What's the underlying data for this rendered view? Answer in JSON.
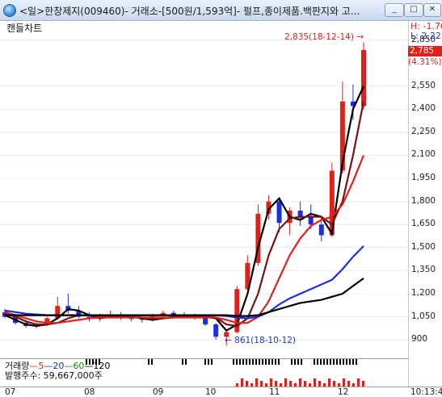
{
  "window": {
    "title": "<일>한창제지(009460)- 거래소-[500원/1,593억]- 펄프,종이제품.백판지와 고...",
    "minimize_label": "_",
    "restore_label": "□",
    "close_label": "✕"
  },
  "chart_label": "캔들차트",
  "price_panel": {
    "high_label": "H: -1.76",
    "current_price": "2,785",
    "change_pct": "(4.31%)",
    "low_label": "L: 2,223"
  },
  "annotations": {
    "high": "2,835(18-12-14) →",
    "low": "← 861(18-10-12)"
  },
  "volume_legend": {
    "title": "거래량",
    "ma5": "—5",
    "ma20": "—20",
    "ma60": "—60",
    "ma120": "—120"
  },
  "shares_outstanding": "발행주수: 59,667,000주",
  "clock": "10:13:4",
  "colors": {
    "up": "#e0201a",
    "down": "#1c2fe0",
    "ma5": "#000000",
    "ma20": "#7a1010",
    "ma60": "#e0201a",
    "ma120": "#1c2fe0",
    "ma240": "#000000"
  },
  "chart_data": {
    "type": "candlestick",
    "title": "캔들차트",
    "ylim": [
      780,
      2900
    ],
    "yticks": [
      900,
      1050,
      1200,
      1350,
      1500,
      1650,
      1800,
      1950,
      2100,
      2250,
      2400,
      2550,
      2850
    ],
    "ytick_labels": [
      "900",
      "1,050",
      "1,200",
      "1,350",
      "1,500",
      "1,650",
      "1,800",
      "1,950",
      "2,100",
      "2,250",
      "2,400",
      "2,550",
      "2,850"
    ],
    "x_labels": [
      "07",
      "08",
      "09",
      "10",
      "11",
      "12"
    ],
    "high_point": {
      "value": 2835,
      "date": "18-12-14"
    },
    "low_point": {
      "value": 861,
      "date": "18-10-12"
    },
    "last_close": 2785,
    "series": [
      {
        "name": "5",
        "color": "#000000",
        "values": [
          1060,
          1030,
          1000,
          990,
          1000,
          1040,
          1100,
          1090,
          1060,
          1040,
          1050,
          1060,
          1050,
          1040,
          1030,
          1040,
          1050,
          1060,
          1060,
          1050,
          1040,
          960,
          1000,
          1200,
          1500,
          1750,
          1820,
          1700,
          1680,
          1720,
          1700,
          1590,
          2050,
          2400,
          2550
        ]
      },
      {
        "name": "20",
        "color": "#7a1010",
        "values": [
          1070,
          1050,
          1020,
          1000,
          1000,
          1010,
          1040,
          1060,
          1060,
          1050,
          1050,
          1050,
          1050,
          1045,
          1040,
          1040,
          1045,
          1050,
          1055,
          1050,
          1045,
          1000,
          990,
          1040,
          1200,
          1450,
          1620,
          1690,
          1700,
          1700,
          1700,
          1650,
          1800,
          2100,
          2450
        ]
      },
      {
        "name": "60",
        "color": "#e0201a",
        "values": [
          1080,
          1060,
          1040,
          1020,
          1010,
          1010,
          1020,
          1030,
          1040,
          1045,
          1045,
          1045,
          1045,
          1045,
          1045,
          1045,
          1045,
          1045,
          1045,
          1045,
          1045,
          1030,
          1010,
          1010,
          1050,
          1150,
          1300,
          1450,
          1560,
          1640,
          1680,
          1700,
          1780,
          1930,
          2100
        ]
      },
      {
        "name": "120",
        "color": "#1c2fe0",
        "values": [
          1090,
          1080,
          1070,
          1065,
          1060,
          1060,
          1060,
          1060,
          1060,
          1060,
          1060,
          1060,
          1060,
          1060,
          1060,
          1060,
          1060,
          1060,
          1060,
          1060,
          1060,
          1055,
          1045,
          1040,
          1050,
          1080,
          1130,
          1170,
          1200,
          1230,
          1260,
          1290,
          1360,
          1440,
          1510
        ]
      },
      {
        "name": "240",
        "color": "#000000",
        "values": [
          1060,
          1060,
          1060,
          1060,
          1060,
          1060,
          1060,
          1060,
          1060,
          1060,
          1060,
          1060,
          1060,
          1060,
          1060,
          1060,
          1060,
          1060,
          1060,
          1060,
          1060,
          1060,
          1055,
          1055,
          1060,
          1080,
          1100,
          1120,
          1140,
          1150,
          1160,
          1180,
          1200,
          1250,
          1300
        ]
      }
    ],
    "candles": [
      {
        "o": 1080,
        "h": 1100,
        "l": 1040,
        "c": 1050
      },
      {
        "o": 1050,
        "h": 1070,
        "l": 1000,
        "c": 1010
      },
      {
        "o": 1010,
        "h": 1030,
        "l": 980,
        "c": 990
      },
      {
        "o": 990,
        "h": 1010,
        "l": 975,
        "c": 1000
      },
      {
        "o": 1000,
        "h": 1050,
        "l": 990,
        "c": 1040
      },
      {
        "o": 1040,
        "h": 1180,
        "l": 1030,
        "c": 1120
      },
      {
        "o": 1120,
        "h": 1200,
        "l": 1070,
        "c": 1090
      },
      {
        "o": 1090,
        "h": 1120,
        "l": 1040,
        "c": 1050
      },
      {
        "o": 1050,
        "h": 1080,
        "l": 1020,
        "c": 1040
      },
      {
        "o": 1040,
        "h": 1070,
        "l": 1020,
        "c": 1055
      },
      {
        "o": 1055,
        "h": 1090,
        "l": 1040,
        "c": 1060
      },
      {
        "o": 1060,
        "h": 1080,
        "l": 1030,
        "c": 1045
      },
      {
        "o": 1045,
        "h": 1060,
        "l": 1020,
        "c": 1035
      },
      {
        "o": 1035,
        "h": 1050,
        "l": 1010,
        "c": 1030
      },
      {
        "o": 1030,
        "h": 1070,
        "l": 1020,
        "c": 1060
      },
      {
        "o": 1060,
        "h": 1090,
        "l": 1040,
        "c": 1075
      },
      {
        "o": 1075,
        "h": 1090,
        "l": 1050,
        "c": 1060
      },
      {
        "o": 1060,
        "h": 1080,
        "l": 1040,
        "c": 1050
      },
      {
        "o": 1050,
        "h": 1070,
        "l": 1030,
        "c": 1040
      },
      {
        "o": 1040,
        "h": 1050,
        "l": 990,
        "c": 1000
      },
      {
        "o": 1000,
        "h": 1010,
        "l": 900,
        "c": 920
      },
      {
        "o": 920,
        "h": 960,
        "l": 861,
        "c": 950
      },
      {
        "o": 950,
        "h": 1250,
        "l": 940,
        "c": 1230
      },
      {
        "o": 1230,
        "h": 1450,
        "l": 1200,
        "c": 1400
      },
      {
        "o": 1400,
        "h": 1780,
        "l": 1380,
        "c": 1720
      },
      {
        "o": 1720,
        "h": 1840,
        "l": 1680,
        "c": 1800
      },
      {
        "o": 1800,
        "h": 1820,
        "l": 1600,
        "c": 1660
      },
      {
        "o": 1660,
        "h": 1760,
        "l": 1580,
        "c": 1740
      },
      {
        "o": 1740,
        "h": 1800,
        "l": 1640,
        "c": 1700
      },
      {
        "o": 1700,
        "h": 1780,
        "l": 1620,
        "c": 1650
      },
      {
        "o": 1650,
        "h": 1700,
        "l": 1540,
        "c": 1580
      },
      {
        "o": 1580,
        "h": 2050,
        "l": 1570,
        "c": 2000
      },
      {
        "o": 2000,
        "h": 2580,
        "l": 1980,
        "c": 2450
      },
      {
        "o": 2450,
        "h": 2560,
        "l": 2330,
        "c": 2420
      },
      {
        "o": 2420,
        "h": 2835,
        "l": 2400,
        "c": 2785
      }
    ]
  }
}
